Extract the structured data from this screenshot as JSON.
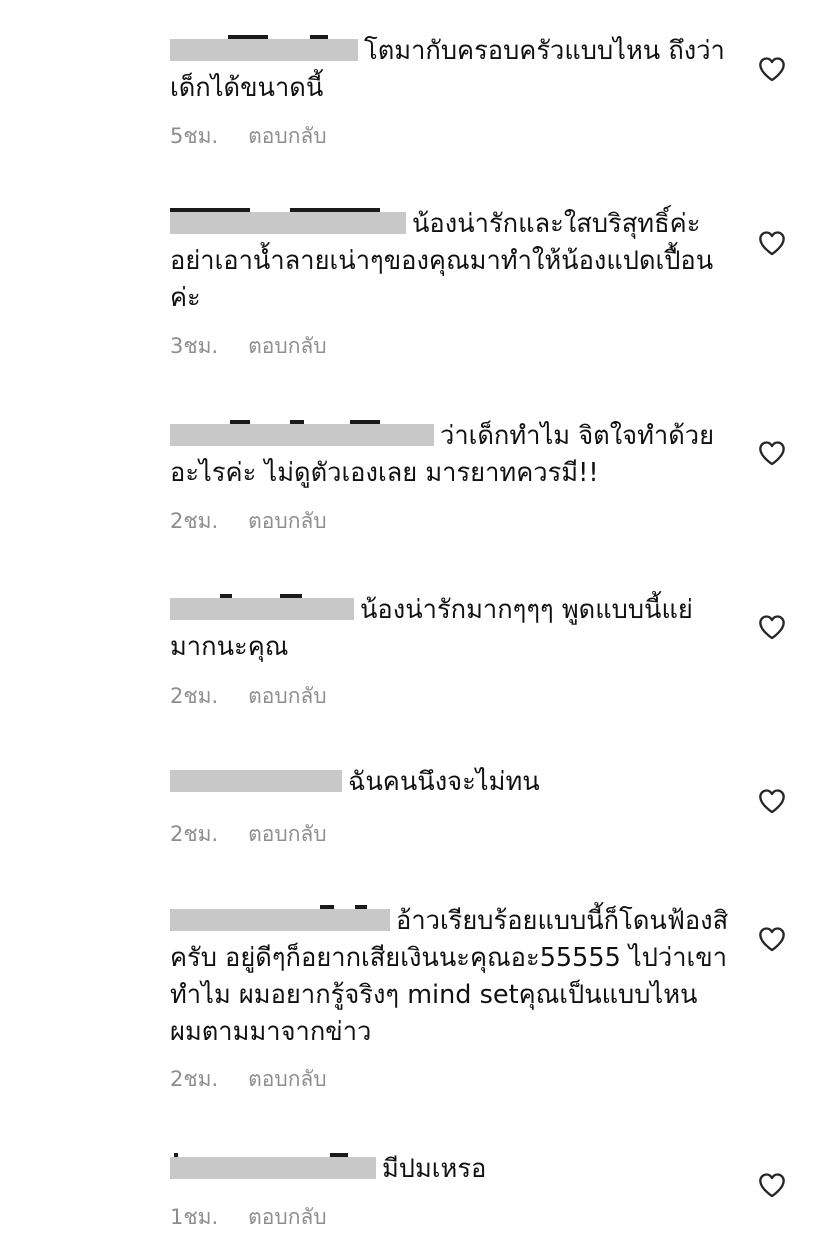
{
  "comments": [
    {
      "text": "โตมากับครอบครัวแบบไหน ถึงว่าเด็กได้ขนาดนี้",
      "time": "5ชม.",
      "reply": "ตอบกลับ",
      "icon": "heart-outline-icon"
    },
    {
      "text": "น้องน่ารักและใสบริสุทธิ์ค่ะ อย่าเอาน้ำลายเน่าๆของคุณมาทำให้น้องแปดเปื้อนค่ะ",
      "time": "3ชม.",
      "reply": "ตอบกลับ",
      "icon": "heart-outline-icon"
    },
    {
      "text": "ว่าเด็กทำไม จิตใจทำด้วยอะไรค่ะ ไม่ดูตัวเองเลย มารยาทควรมี!!",
      "time": "2ชม.",
      "reply": "ตอบกลับ",
      "icon": "heart-outline-icon"
    },
    {
      "text": "น้องน่ารักมากๆๆๆ พูดแบบนี้แย่มากนะคุณ",
      "time": "2ชม.",
      "reply": "ตอบกลับ",
      "icon": "heart-outline-icon"
    },
    {
      "text": "ฉันคนนึงจะไม่ทน",
      "time": "2ชม.",
      "reply": "ตอบกลับ",
      "icon": "heart-outline-icon"
    },
    {
      "text": "อ้าวเรียบร้อยแบบนี้ก็โดนฟ้องสิครับ อยู่ดีๆก็อยากเสียเงินนะคุณอะ55555 ไปว่าเขาทำไม ผมอยากรู้จริงๆ mind setคุณเป็นแบบไหน ผมตามมาจากข่าว",
      "time": "2ชม.",
      "reply": "ตอบกลับ",
      "icon": "heart-outline-icon"
    },
    {
      "text": "มีปมเหรอ",
      "time": "1ชม.",
      "reply": "ตอบกลับ",
      "icon": "heart-outline-icon"
    }
  ],
  "colors": {
    "text": "#111111",
    "meta": "#8e8e8e",
    "redaction": "#c8c8c8",
    "heart_stroke": "#262626"
  }
}
